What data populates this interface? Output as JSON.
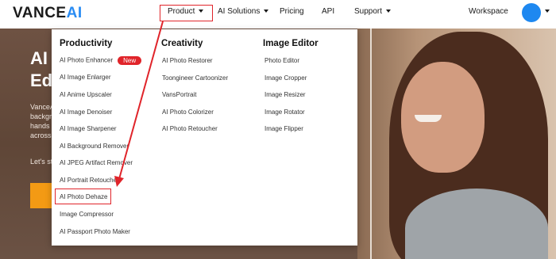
{
  "header": {
    "logo_main": "VANCE",
    "logo_accent": "AI",
    "nav": {
      "product": "Product",
      "solutions": "AI Solutions",
      "pricing": "Pricing",
      "api": "API",
      "support": "Support",
      "workspace": "Workspace"
    }
  },
  "hero": {
    "title_line1": "AI",
    "title_line2": "Ed",
    "text_lines": [
      "VanceA",
      "backgro",
      "hands f",
      "across"
    ],
    "lets_start": "Let's st"
  },
  "dropdown": {
    "productivity": {
      "title": "Productivity",
      "items": [
        "AI Photo Enhancer",
        "AI Image Enlarger",
        "AI Anime Upscaler",
        "AI Image Denoiser",
        "AI Image Sharpener",
        "AI Background Remover",
        "AI JPEG Artifact Remover",
        "AI Portrait Retoucher",
        "AI Photo Dehaze",
        "Image Compressor",
        "AI Passport Photo Maker"
      ],
      "new_badge": "New"
    },
    "creativity": {
      "title": "Creativity",
      "items": [
        "AI Photo Restorer",
        "Toongineer Cartoonizer",
        "VansPortrait",
        "AI Photo Colorizer",
        "AI Photo Retoucher"
      ]
    },
    "image_editor": {
      "title": "Image Editor",
      "items": [
        "Photo Editor",
        "Image Cropper",
        "Image Resizer",
        "Image Rotator",
        "Image Flipper"
      ]
    }
  },
  "colors": {
    "accent_blue": "#2a8cf3",
    "highlight_red": "#e0242a",
    "cta_orange": "#f39a14"
  },
  "icons": {
    "caret": "caret-down-icon",
    "avatar": "avatar"
  }
}
